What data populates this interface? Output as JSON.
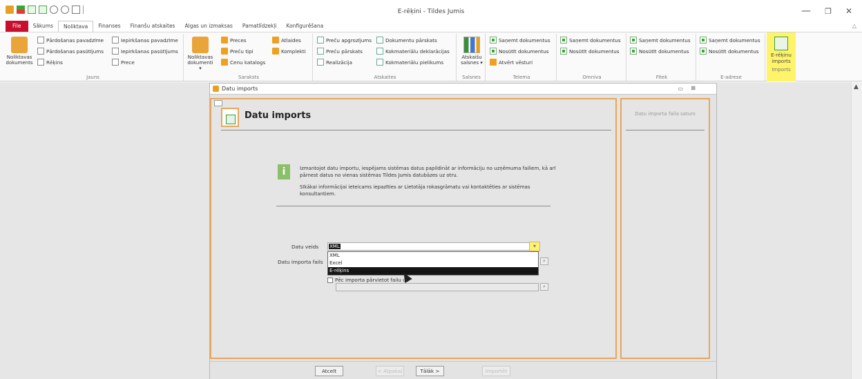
{
  "window": {
    "title": "E-rēķini - Tildes Jumis",
    "minimize": "—",
    "restore": "❐",
    "close": "✕",
    "collapse": "△"
  },
  "tabs": [
    {
      "label": "File"
    },
    {
      "label": "Sākums"
    },
    {
      "label": "Noliktava"
    },
    {
      "label": "Finanses"
    },
    {
      "label": "Finanšu atskaites"
    },
    {
      "label": "Algas un izmaksas"
    },
    {
      "label": "Pamatlīdzekļi"
    },
    {
      "label": "Konfigurēšana"
    }
  ],
  "ribbon": {
    "jauns": {
      "label": "Jauns",
      "big": "Noliktavas dokuments",
      "items": [
        "Pārdošanas pavadzīme",
        "Pārdošanas pasūtījums",
        "Rēķins",
        "Iepirkšanas pavadzīme",
        "Iepirkšanas pasūtījums",
        "Prece"
      ]
    },
    "saraksts": {
      "label": "Saraksts",
      "big": "Noliktavas dokumenti ▾",
      "items": [
        "Preces",
        "Preču tipi",
        "Cenu katalogs",
        "Atlaides",
        "Komplekti"
      ]
    },
    "atskaites": {
      "label": "Atskaites",
      "items": [
        "Preču apgrozījums",
        "Preču pārskats",
        "Realizācija",
        "Dokumentu pārskats",
        "Kokmateriālu deklarācijas",
        "Kokmateriālu pielikums"
      ]
    },
    "salsnes": {
      "label": "Salsnes",
      "big": "Atskaišu salsnes ▾"
    },
    "telema": {
      "label": "Telema",
      "items": [
        "Saņemt dokumentus",
        "Nosūtīt dokumentus",
        "Atvērt vēsturi"
      ]
    },
    "omniva": {
      "label": "Omniva",
      "items": [
        "Saņemt dokumentus",
        "Nosūtīt dokumentus"
      ]
    },
    "fitek": {
      "label": "Fitek",
      "items": [
        "Saņemt dokumentus",
        "Nosūtīt dokumentus"
      ]
    },
    "eadrese": {
      "label": "E-adrese",
      "items": [
        "Saņemt dokumentus",
        "Nosūtīt dokumentus"
      ]
    },
    "imports": {
      "label": "Imports",
      "big1": "E-rēķinu",
      "big2": "imports"
    }
  },
  "dialog": {
    "title": "Datu imports",
    "heading": "Datu imports",
    "side_title": "Datu importa faila saturs",
    "info_p1": "Izmantojot datu importu, iespējams sistēmas datus papildināt ar informāciju no uzņēmuma failiem, kā arī pārnest datus no vienas sistēmas Tildes Jumis datubāzes uz otru.",
    "info_p2": "Sīkākai informācijai ieteicams iepazīties ar Lietotāja rokasgrāmatu vai kontaktēties ar sistēmas konsultantiem.",
    "datu_veids_label": "Datu veids",
    "datu_veids_value": "XML",
    "datu_fails_label": "Datu importa fails",
    "dropdown_options": [
      "XML",
      "Excel",
      "E-rēķins"
    ],
    "checkbox_label": "Pēc importa pārvietot failu uz",
    "buttons": {
      "cancel": "Atcelt",
      "back": "< Atpakaļ",
      "next": "Tālāk >",
      "import": "Importēt"
    }
  },
  "colors": {
    "file_tab": "#c8102e",
    "highlight": "#fff36a",
    "panel_border": "#e8a55a"
  }
}
